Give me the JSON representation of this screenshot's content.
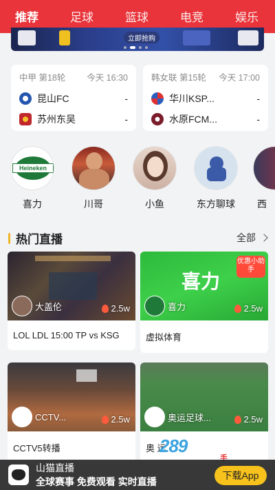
{
  "tabs": [
    {
      "label": "推荐",
      "active": true
    },
    {
      "label": "足球",
      "active": false
    },
    {
      "label": "篮球",
      "active": false
    },
    {
      "label": "电竞",
      "active": false
    },
    {
      "label": "娱乐",
      "active": false
    }
  ],
  "banner": {
    "text": "立即抢购"
  },
  "matches": [
    {
      "league": "中甲 第18轮",
      "time": "今天 16:30",
      "home": {
        "name": "昆山FC",
        "score": "-"
      },
      "away": {
        "name": "苏州东吴",
        "score": "-"
      }
    },
    {
      "league": "韩女联 第15轮",
      "time": "今天 17:00",
      "home": {
        "name": "华川KSP...",
        "score": "-"
      },
      "away": {
        "name": "水原FCM...",
        "score": "-"
      }
    }
  ],
  "streamers": [
    {
      "name": "喜力",
      "avatar_text": "Heineken"
    },
    {
      "name": "川哥"
    },
    {
      "name": "小鱼"
    },
    {
      "name": "东方聊球"
    },
    {
      "name": "西"
    }
  ],
  "section": {
    "title": "热门直播",
    "more": "全部"
  },
  "streams": [
    {
      "host": "大盖伦",
      "heat": "2.5w",
      "title": "LOL LDL 15:00 TP vs KSG"
    },
    {
      "host": "喜力",
      "heat": "2.5w",
      "title": "虚拟体育",
      "overlay": "喜力",
      "badge": "优惠小助手"
    },
    {
      "host": "CCTV...",
      "heat": "2.5w",
      "title": "CCTV5转播"
    },
    {
      "host": "奥运足球...",
      "heat": "2.5w",
      "title": "奥 运"
    }
  ],
  "promo": {
    "app_name": "山猫直播",
    "slogan": "全球赛事 免费观看 实时直播",
    "button": "下载App"
  },
  "watermark": {
    "text": "289",
    "sub": "手游网"
  },
  "colors": {
    "header": "#e8343a",
    "accent": "#f0b428",
    "button": "#f7c21c"
  }
}
